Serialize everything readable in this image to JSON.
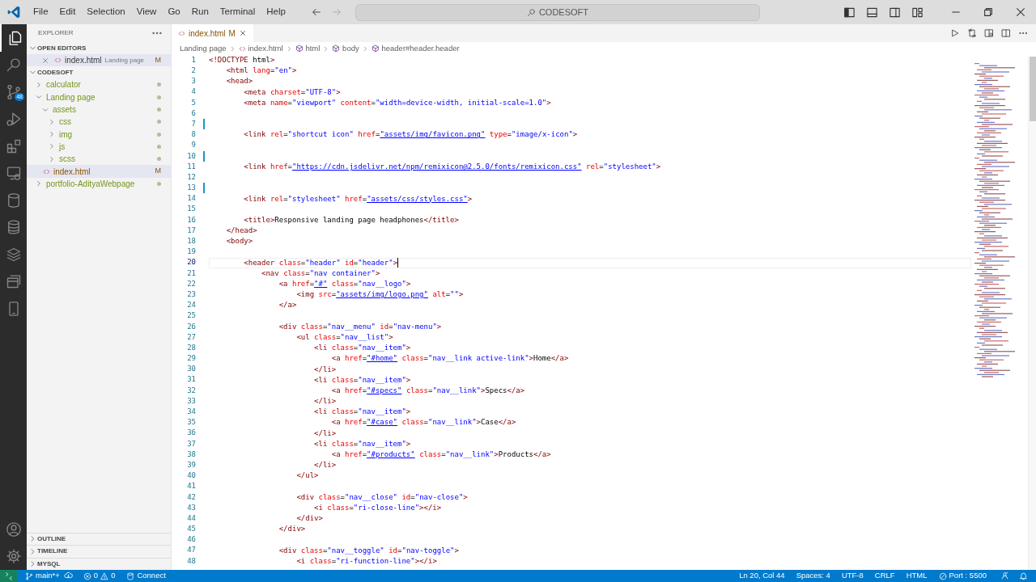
{
  "title_bar": {
    "menus": [
      "File",
      "Edit",
      "Selection",
      "View",
      "Go",
      "Run",
      "Terminal",
      "Help"
    ],
    "search": "CODESOFT"
  },
  "activity_bar": {
    "items": [
      {
        "kind": "files",
        "selected": true
      },
      {
        "kind": "search",
        "selected": false
      },
      {
        "kind": "source-control",
        "selected": false,
        "badge": "48"
      },
      {
        "kind": "run",
        "selected": false
      },
      {
        "kind": "extensions",
        "selected": false
      },
      {
        "kind": "remote",
        "selected": false
      },
      {
        "kind": "database",
        "selected": false
      },
      {
        "kind": "database-stack",
        "selected": false
      },
      {
        "kind": "layers",
        "selected": false
      },
      {
        "kind": "panels",
        "selected": false
      },
      {
        "kind": "phone",
        "selected": false
      }
    ],
    "bottom": [
      {
        "kind": "account"
      },
      {
        "kind": "settings"
      }
    ]
  },
  "sidebar": {
    "title": "EXPLORER",
    "open_editors": {
      "label": "OPEN EDITORS",
      "expanded": true,
      "items": [
        {
          "name": "index.html",
          "description": "Landing page",
          "badge": "M",
          "selected": true
        }
      ]
    },
    "folder": {
      "label": "CODESOFT",
      "expanded": true,
      "items": [
        {
          "name": "calculator",
          "kind": "folder",
          "expanded": false,
          "modified": false,
          "selected": false
        },
        {
          "name": "Landing page",
          "kind": "folder",
          "expanded": true,
          "modified": false,
          "selected": false,
          "children": [
            {
              "name": "assets",
              "kind": "folder",
              "expanded": true,
              "modified": false,
              "selected": false,
              "children": [
                {
                  "name": "css",
                  "kind": "folder",
                  "expanded": false,
                  "modified": false,
                  "selected": false
                },
                {
                  "name": "img",
                  "kind": "folder",
                  "expanded": false,
                  "modified": false,
                  "selected": false
                },
                {
                  "name": "js",
                  "kind": "folder",
                  "expanded": false,
                  "modified": false,
                  "selected": false
                },
                {
                  "name": "scss",
                  "kind": "folder",
                  "expanded": false,
                  "modified": false,
                  "selected": false
                }
              ]
            },
            {
              "name": "index.html",
              "kind": "file",
              "modified": true,
              "badge": "M",
              "selected": true
            }
          ]
        },
        {
          "name": "portfolio-AdityaWebpage",
          "kind": "folder",
          "expanded": false,
          "modified": false,
          "selected": false
        }
      ]
    },
    "panels": [
      {
        "label": "OUTLINE",
        "expanded": false
      },
      {
        "label": "TIMELINE",
        "expanded": false
      },
      {
        "label": "MYSQL",
        "expanded": false
      }
    ]
  },
  "tabs": [
    {
      "label": "index.html",
      "badge": "M",
      "selected": true
    }
  ],
  "breadcrumbs": [
    {
      "label": "Landing page",
      "kind": "folder"
    },
    {
      "label": "index.html",
      "kind": "file"
    },
    {
      "label": "html",
      "kind": "element"
    },
    {
      "label": "body",
      "kind": "element"
    },
    {
      "label": "header#header.header",
      "kind": "element"
    }
  ],
  "editor": {
    "lines": [
      {
        "number": "1",
        "text": "<!DOCTYPE html>"
      },
      {
        "number": "2",
        "text": "    <html lang=\"en\">"
      },
      {
        "number": "3",
        "text": "    <head>"
      },
      {
        "number": "4",
        "text": "        <meta charset=\"UTF-8\">"
      },
      {
        "number": "5",
        "text": "        <meta name=\"viewport\" content=\"width=device-width, initial-scale=1.0\">"
      },
      {
        "number": "6"
      },
      {
        "number": "7",
        "modified": true
      },
      {
        "number": "8",
        "text": "        <link rel=\"shortcut icon\" href=\"assets/img/favicon.png\" type=\"image/x-icon\">"
      },
      {
        "number": "9"
      },
      {
        "number": "10",
        "modified": true
      },
      {
        "number": "11",
        "text": "        <link href=\"https://cdn.jsdelivr.net/npm/remixicon@2.5.0/fonts/remixicon.css\" rel=\"stylesheet\">"
      },
      {
        "number": "12"
      },
      {
        "number": "13",
        "modified": true
      },
      {
        "number": "14",
        "text": "        <link rel=\"stylesheet\" href=\"assets/css/styles.css\">"
      },
      {
        "number": "15"
      },
      {
        "number": "16",
        "text": "        <title>Responsive landing page headphones</title>"
      },
      {
        "number": "17",
        "text": "    </head>"
      },
      {
        "number": "18",
        "text": "    <body>"
      },
      {
        "number": "19"
      },
      {
        "number": "20",
        "text": "        <header class=\"header\" id=\"header\">",
        "current": true
      },
      {
        "number": "21",
        "text": "            <nav class=\"nav container\">"
      },
      {
        "number": "22",
        "text": "                <a href=\"#\" class=\"nav__logo\">"
      },
      {
        "number": "23",
        "text": "                    <img src=\"assets/img/logo.png\" alt=\"\">"
      },
      {
        "number": "24",
        "text": "                </a>"
      },
      {
        "number": "25"
      },
      {
        "number": "26",
        "text": "                <div class=\"nav__menu\" id=\"nav-menu\">"
      },
      {
        "number": "27",
        "text": "                    <ul class=\"nav__list\">"
      },
      {
        "number": "28",
        "text": "                        <li class=\"nav__item\">"
      },
      {
        "number": "29",
        "text": "                            <a href=\"#home\" class=\"nav__link active-link\">Home</a>"
      },
      {
        "number": "30",
        "text": "                        </li>"
      },
      {
        "number": "31",
        "text": "                        <li class=\"nav__item\">"
      },
      {
        "number": "32",
        "text": "                            <a href=\"#specs\" class=\"nav__link\">Specs</a>"
      },
      {
        "number": "33",
        "text": "                        </li>"
      },
      {
        "number": "34",
        "text": "                        <li class=\"nav__item\">"
      },
      {
        "number": "35",
        "text": "                            <a href=\"#case\" class=\"nav__link\">Case</a>"
      },
      {
        "number": "36",
        "text": "                        </li>"
      },
      {
        "number": "37",
        "text": "                        <li class=\"nav__item\">"
      },
      {
        "number": "38",
        "text": "                            <a href=\"#products\" class=\"nav__link\">Products</a>"
      },
      {
        "number": "39",
        "text": "                        </li>"
      },
      {
        "number": "40",
        "text": "                    </ul>"
      },
      {
        "number": "41"
      },
      {
        "number": "42",
        "text": "                    <div class=\"nav__close\" id=\"nav-close\">"
      },
      {
        "number": "43",
        "text": "                        <i class=\"ri-close-line\"></i>"
      },
      {
        "number": "44",
        "text": "                    </div>"
      },
      {
        "number": "45",
        "text": "                </div>"
      },
      {
        "number": "46"
      },
      {
        "number": "47",
        "text": "                <div class=\"nav__toggle\" id=\"nav-toggle\">"
      },
      {
        "number": "48",
        "text": "                    <i class=\"ri-function-line\"></i>"
      }
    ]
  },
  "status_bar": {
    "branch": "main*+",
    "errors": "0",
    "warnings": "0",
    "connect": "Connect",
    "items": [
      "Ln 20, Col 44",
      "Spaces: 4",
      "UTF-8",
      "CRLF",
      "HTML"
    ],
    "port": "Port : 5500"
  }
}
